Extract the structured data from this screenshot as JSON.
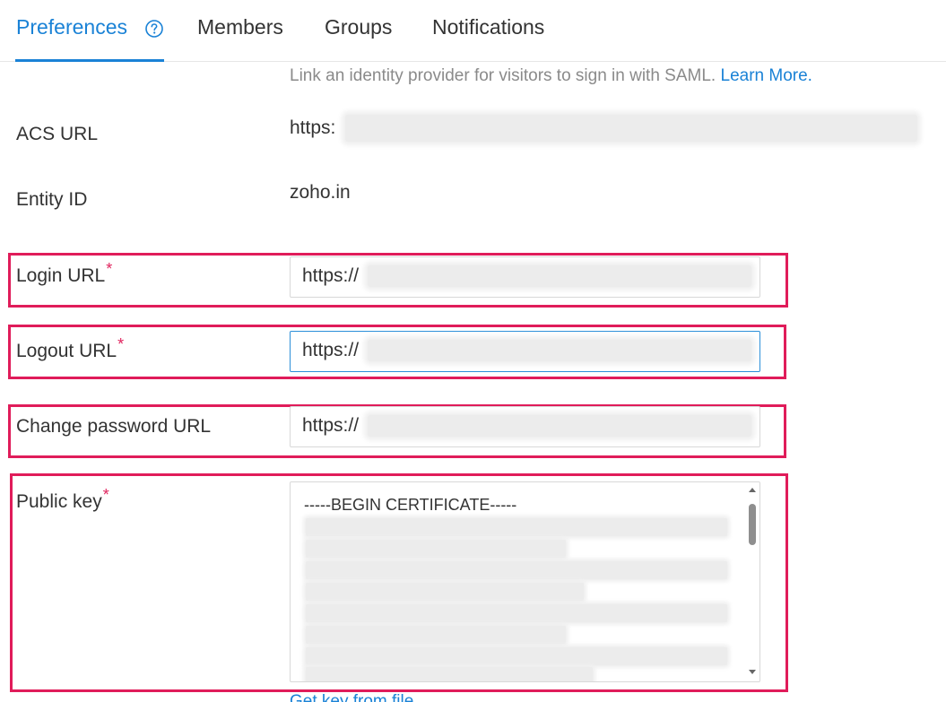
{
  "tabs": {
    "preferences": "Preferences",
    "members": "Members",
    "groups": "Groups",
    "notifications": "Notifications"
  },
  "intro": {
    "text": "Link an identity provider for visitors to sign in with SAML.",
    "learn_more": "Learn More."
  },
  "acs": {
    "label": "ACS URL",
    "value": "https:"
  },
  "entity": {
    "label": "Entity ID",
    "value": "zoho.in"
  },
  "login": {
    "label": "Login URL",
    "required": "*",
    "value": "https://"
  },
  "logout": {
    "label": "Logout URL",
    "required": "*",
    "value": "https://"
  },
  "change_password": {
    "label": "Change password URL",
    "value": "https://"
  },
  "public_key": {
    "label": "Public key",
    "required": "*",
    "first_line": "-----BEGIN CERTIFICATE-----"
  },
  "footer": {
    "link_partial": "Get key from file"
  },
  "colors": {
    "accent": "#1a82d6",
    "highlight": "#e01c5a",
    "required": "#e0245e"
  }
}
